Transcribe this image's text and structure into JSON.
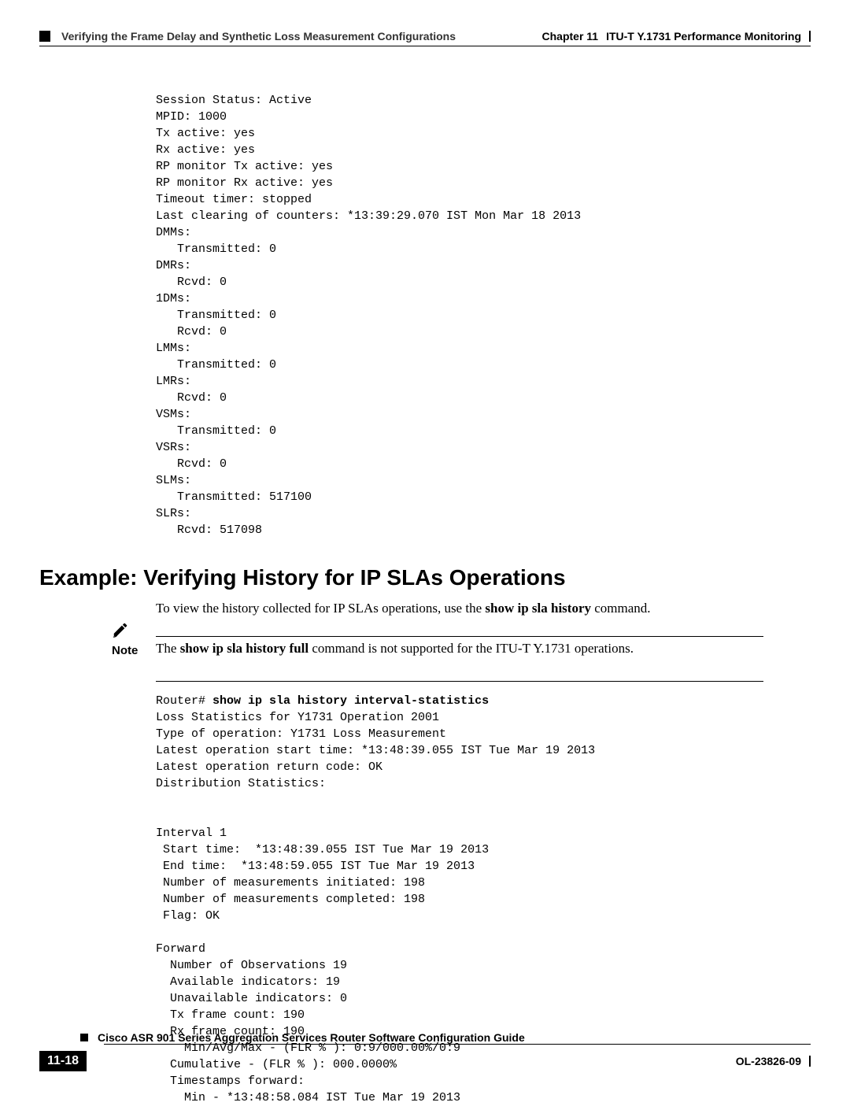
{
  "header": {
    "section_title": "Verifying the Frame Delay and Synthetic Loss Measurement Configurations",
    "chapter_label": "Chapter 11",
    "chapter_title": "ITU-T Y.1731 Performance Monitoring"
  },
  "pre_block_1": "Session Status: Active\nMPID: 1000\nTx active: yes\nRx active: yes\nRP monitor Tx active: yes\nRP monitor Rx active: yes\nTimeout timer: stopped\nLast clearing of counters: *13:39:29.070 IST Mon Mar 18 2013\nDMMs:\n   Transmitted: 0\nDMRs:\n   Rcvd: 0\n1DMs:\n   Transmitted: 0\n   Rcvd: 0\nLMMs:\n   Transmitted: 0\nLMRs:\n   Rcvd: 0\nVSMs:\n   Transmitted: 0\nVSRs:\n   Rcvd: 0\nSLMs:\n   Transmitted: 517100\nSLRs:\n   Rcvd: 517098",
  "h2": "Example: Verifying History for IP SLAs Operations",
  "para1": {
    "pre": "To view the history collected for IP SLAs operations, use the ",
    "bold": "show ip sla history",
    "post": " command."
  },
  "note": {
    "label": "Note",
    "pre": "The ",
    "bold": "show ip sla history full",
    "post": " command is not supported for the ITU-T Y.1731 operations."
  },
  "cmd": {
    "prompt": "Router# ",
    "bold": "show ip sla history interval-statistics"
  },
  "pre_block_2": "Loss Statistics for Y1731 Operation 2001\nType of operation: Y1731 Loss Measurement\nLatest operation start time: *13:48:39.055 IST Tue Mar 19 2013\nLatest operation return code: OK\nDistribution Statistics:\n\n\nInterval 1\n Start time:  *13:48:39.055 IST Tue Mar 19 2013\n End time:  *13:48:59.055 IST Tue Mar 19 2013\n Number of measurements initiated: 198\n Number of measurements completed: 198\n Flag: OK\n\nForward\n  Number of Observations 19\n  Available indicators: 19\n  Unavailable indicators: 0\n  Tx frame count: 190\n  Rx frame count: 190\n    Min/Avg/Max - (FLR % ): 0:9/000.00%/0:9\n  Cumulative - (FLR % ): 000.0000%\n  Timestamps forward:\n    Min - *13:48:58.084 IST Tue Mar 19 2013",
  "footer": {
    "guide_title": "Cisco ASR 901 Series Aggregation Services Router Software Configuration Guide",
    "page_number": "11-18",
    "doc_id": "OL-23826-09"
  }
}
